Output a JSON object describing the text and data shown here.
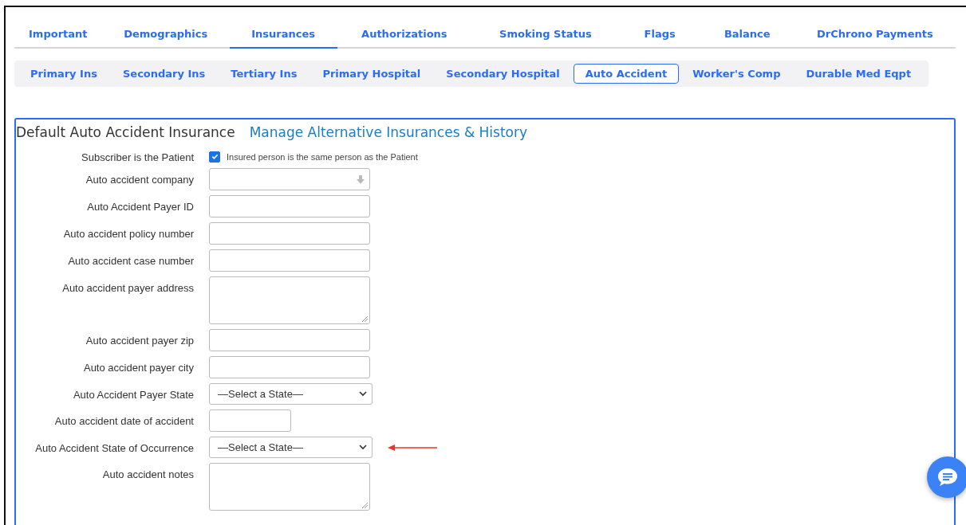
{
  "tabs": [
    {
      "label": "Important",
      "selected": false
    },
    {
      "label": "Demographics",
      "selected": false
    },
    {
      "label": "Insurances",
      "selected": true
    },
    {
      "label": "Authorizations",
      "selected": false
    },
    {
      "label": "Smoking Status",
      "selected": false
    },
    {
      "label": "Flags",
      "selected": false
    },
    {
      "label": "Balance",
      "selected": false
    },
    {
      "label": "DrChrono Payments",
      "selected": false
    }
  ],
  "subtabs": [
    {
      "label": "Primary Ins",
      "selected": false
    },
    {
      "label": "Secondary Ins",
      "selected": false
    },
    {
      "label": "Tertiary Ins",
      "selected": false
    },
    {
      "label": "Primary Hospital",
      "selected": false
    },
    {
      "label": "Secondary Hospital",
      "selected": false
    },
    {
      "label": "Auto Accident",
      "selected": true
    },
    {
      "label": "Worker's Comp",
      "selected": false
    },
    {
      "label": "Durable Med Eqpt",
      "selected": false
    }
  ],
  "panel": {
    "title": "Default Auto Accident Insurance",
    "link": "Manage Alternative Insurances & History"
  },
  "fields": [
    {
      "kind": "checkbox",
      "label": "Subscriber is the Patient",
      "checked": true,
      "text": "Insured person is the same person as the Patient"
    },
    {
      "kind": "combo",
      "label": "Auto accident company"
    },
    {
      "kind": "text",
      "label": "Auto Accident Payer ID"
    },
    {
      "kind": "text",
      "label": "Auto accident policy number"
    },
    {
      "kind": "text",
      "label": "Auto accident case number"
    },
    {
      "kind": "textarea",
      "label": "Auto accident payer address"
    },
    {
      "kind": "text",
      "label": "Auto accident payer zip"
    },
    {
      "kind": "text",
      "label": "Auto accident payer city"
    },
    {
      "kind": "select",
      "label": "Auto Accident Payer State",
      "value": "—Select a State—"
    },
    {
      "kind": "date",
      "label": "Auto accident date of accident"
    },
    {
      "kind": "select",
      "label": "Auto Accident State of Occurrence",
      "value": "—Select a State—",
      "marked": true
    },
    {
      "kind": "textarea",
      "label": "Auto accident notes"
    }
  ]
}
